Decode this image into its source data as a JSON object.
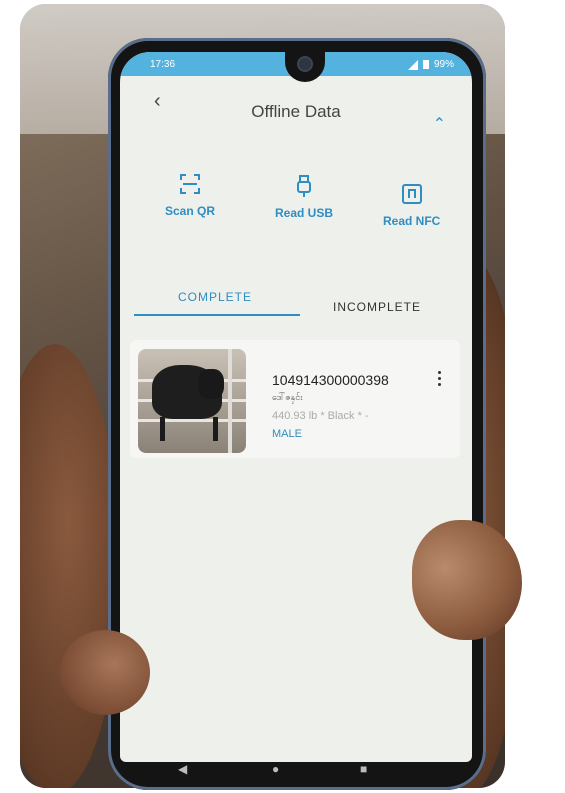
{
  "status": {
    "time": "17:36",
    "battery": "99%"
  },
  "header": {
    "title": "Offline Data",
    "back_icon": "back-icon",
    "collapse_icon": "collapse-icon"
  },
  "actions": [
    {
      "label": "Scan QR",
      "icon": "qr-scan-icon"
    },
    {
      "label": "Read USB",
      "icon": "usb-icon"
    },
    {
      "label": "Read NFC",
      "icon": "nfc-icon"
    }
  ],
  "tabs": [
    {
      "label": "COMPLETE",
      "active": true
    },
    {
      "label": "INCOMPLETE",
      "active": false
    }
  ],
  "records": [
    {
      "tag": "104914300000398",
      "owner": "ဒေါ်ဇနှင်း",
      "info": "440.93 lb * Black * -",
      "sex": "MALE"
    }
  ],
  "colors": {
    "accent": "#2f8dc1",
    "statusbar": "#54b2df",
    "background": "#eef0ec"
  }
}
